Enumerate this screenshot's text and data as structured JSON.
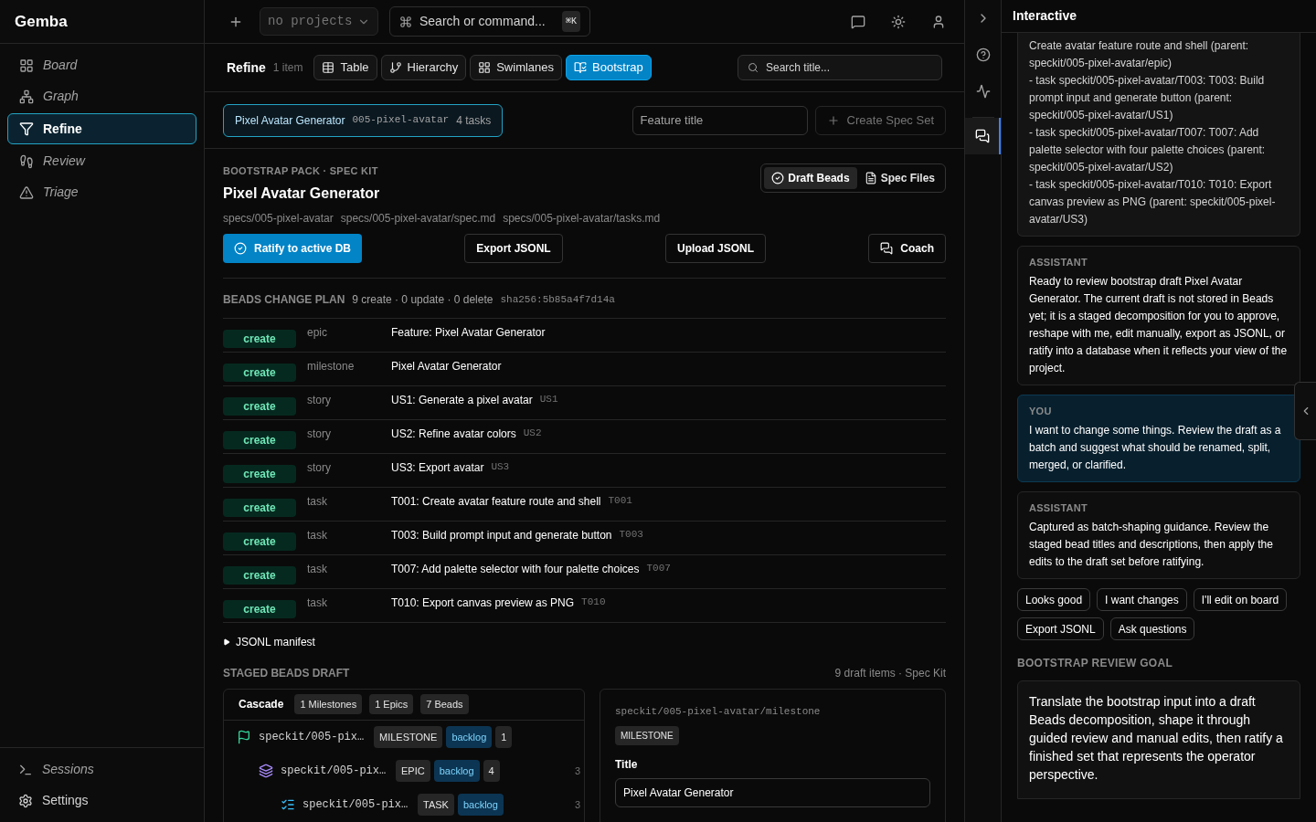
{
  "app": {
    "name": "Gemba"
  },
  "sidebar": {
    "items": [
      {
        "label": "Board",
        "selected": false,
        "italic": true
      },
      {
        "label": "Graph",
        "selected": false,
        "italic": true
      },
      {
        "label": "Refine",
        "selected": true,
        "italic": false
      },
      {
        "label": "Review",
        "selected": false,
        "italic": true
      },
      {
        "label": "Triage",
        "selected": false,
        "italic": true
      }
    ],
    "footer_items": [
      {
        "label": "Sessions",
        "italic": true
      },
      {
        "label": "Settings",
        "italic": false
      }
    ]
  },
  "topbar": {
    "project_select": {
      "value": "no projects"
    },
    "search": {
      "placeholder": "Search or command...",
      "shortcut": "⌘K"
    }
  },
  "toolbar": {
    "title": "Refine",
    "count": "1 item",
    "views": [
      {
        "label": "Table",
        "selected": false
      },
      {
        "label": "Hierarchy",
        "selected": false
      },
      {
        "label": "Swimlanes",
        "selected": false
      },
      {
        "label": "Bootstrap",
        "selected": true
      }
    ],
    "search": {
      "placeholder": "Search title..."
    }
  },
  "feature_bar": {
    "chip": {
      "title": "Pixel Avatar Generator",
      "slug": "005-pixel-avatar",
      "count": "4 tasks",
      "selected": true
    },
    "title_field": {
      "placeholder": "Feature title"
    },
    "create_button": {
      "label": "Create Spec Set",
      "disabled": true
    }
  },
  "pack": {
    "eyebrow": "BOOTSTRAP PACK · SPEC KIT",
    "title": "Pixel Avatar Generator",
    "paths": [
      "specs/005-pixel-avatar",
      "specs/005-pixel-avatar/spec.md",
      "specs/005-pixel-avatar/tasks.md"
    ],
    "segments": [
      {
        "label": "Draft Beads",
        "selected": true
      },
      {
        "label": "Spec Files",
        "selected": false
      }
    ],
    "actions": [
      {
        "label": "Ratify to active DB",
        "kind": "primary"
      },
      {
        "label": "Export JSONL",
        "kind": "outline"
      },
      {
        "label": "Upload JSONL",
        "kind": "outline"
      },
      {
        "label": "Coach",
        "kind": "coach"
      }
    ]
  },
  "plan": {
    "title": "BEADS CHANGE PLAN",
    "summary": "9 create · 0 update · 0 delete",
    "hash": "sha256:5b85a4f7d14a",
    "rows": [
      {
        "action": "create",
        "type": "epic",
        "title": "Feature: Pixel Avatar Generator"
      },
      {
        "action": "create",
        "type": "milestone",
        "title": "Pixel Avatar Generator"
      },
      {
        "action": "create",
        "type": "story",
        "title": "US1: Generate a pixel avatar",
        "id": "US1"
      },
      {
        "action": "create",
        "type": "story",
        "title": "US2: Refine avatar colors",
        "id": "US2"
      },
      {
        "action": "create",
        "type": "story",
        "title": "US3: Export avatar",
        "id": "US3"
      },
      {
        "action": "create",
        "type": "task",
        "title": "T001: Create avatar feature route and shell",
        "id": "T001"
      },
      {
        "action": "create",
        "type": "task",
        "title": "T003: Build prompt input and generate button",
        "id": "T003"
      },
      {
        "action": "create",
        "type": "task",
        "title": "T007: Add palette selector with four palette choices",
        "id": "T007"
      },
      {
        "action": "create",
        "type": "task",
        "title": "T010: Export canvas preview as PNG",
        "id": "T010"
      }
    ]
  },
  "manifest": {
    "label": "JSONL manifest",
    "expanded": false
  },
  "staged": {
    "title": "STAGED BEADS DRAFT",
    "meta": "9 draft items · Spec Kit",
    "cascade": {
      "title": "Cascade",
      "badges": [
        "1 Milestones",
        "1 Epics",
        "7 Beads"
      ],
      "tree": [
        {
          "kind": "milestone",
          "name": "speckit/005-pix…",
          "type": "MILESTONE",
          "status": "backlog",
          "count": "1",
          "children": [
            {
              "kind": "epic",
              "name": "speckit/005-pix…",
              "type": "EPIC",
              "status": "backlog",
              "count": "4",
              "extra": "3",
              "children": [
                {
                  "kind": "task",
                  "name": "speckit/005-pix…",
                  "type": "TASK",
                  "status": "backlog",
                  "extra": "3"
                }
              ]
            }
          ]
        }
      ]
    },
    "detail": {
      "path": "speckit/005-pixel-avatar/milestone",
      "type": "MILESTONE",
      "title_label": "Title",
      "title_value": "Pixel Avatar Generator"
    }
  },
  "rail": [
    {
      "selected": false
    },
    {
      "selected": false
    },
    {
      "selected": false
    },
    {
      "selected": true
    }
  ],
  "chat": {
    "title": "Interactive",
    "messages": [
      {
        "kind": "draft",
        "text": "Create avatar feature route and shell (parent: speckit/005-pixel-avatar/epic)\n- task speckit/005-pixel-avatar/T003: T003: Build prompt input and generate button (parent: speckit/005-pixel-avatar/US1)\n- task speckit/005-pixel-avatar/T007: T007: Add palette selector with four palette choices (parent: speckit/005-pixel-avatar/US2)\n- task speckit/005-pixel-avatar/T010: T010: Export canvas preview as PNG (parent: speckit/005-pixel-avatar/US3)"
      },
      {
        "kind": "assistant",
        "role": "ASSISTANT",
        "text": "Ready to review bootstrap draft Pixel Avatar Generator. The current draft is not stored in Beads yet; it is a staged decomposition for you to approve, reshape with me, edit manually, export as JSONL, or ratify into a database when it reflects your view of the project."
      },
      {
        "kind": "user",
        "role": "YOU",
        "text": "I want to change some things. Review the draft as a batch and suggest what should be renamed, split, merged, or clarified."
      },
      {
        "kind": "assistant",
        "role": "ASSISTANT",
        "text": "Captured as batch-shaping guidance. Review the staged bead titles and descriptions, then apply the edits to the draft set before ratifying."
      }
    ],
    "quick_replies": [
      "Looks good",
      "I want changes",
      "I'll edit on board",
      "Export JSONL",
      "Ask questions"
    ],
    "goal": {
      "title": "BOOTSTRAP REVIEW GOAL",
      "text": "Translate the bootstrap input into a draft Beads decomposition, shape it through guided review and manual edits, then ratify a finished set that represents the operator perspective."
    }
  }
}
